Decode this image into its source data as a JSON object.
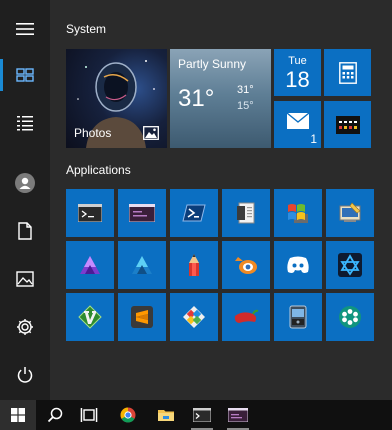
{
  "colors": {
    "tile_blue": "#0b6fc2",
    "accent": "#1a8ad4",
    "panel": "#2b2b2b",
    "taskbar": "#101010"
  },
  "rail": {
    "items": [
      {
        "name": "hamburger-menu-icon"
      },
      {
        "name": "tiles-view-icon"
      },
      {
        "name": "all-apps-list-icon"
      },
      {
        "name": "user-account-icon"
      },
      {
        "name": "documents-icon"
      },
      {
        "name": "pictures-icon"
      },
      {
        "name": "settings-gear-icon"
      },
      {
        "name": "power-icon"
      }
    ]
  },
  "groups": {
    "system": {
      "title": "System",
      "photos": {
        "label": "Photos"
      },
      "weather": {
        "condition": "Partly Sunny",
        "temp": "31°",
        "high": "31°",
        "low": "15°"
      },
      "calendar": {
        "day": "Tue",
        "date": "18"
      },
      "mail": {
        "count": "1"
      }
    },
    "applications": {
      "title": "Applications",
      "tiles": [
        {
          "icon": "terminal-icon"
        },
        {
          "icon": "console-window-icon"
        },
        {
          "icon": "powershell-icon"
        },
        {
          "icon": "document-viewer-icon"
        },
        {
          "icon": "windows-flag-icon"
        },
        {
          "icon": "control-panel-icon"
        },
        {
          "icon": "affinity-photo-icon"
        },
        {
          "icon": "affinity-designer-icon"
        },
        {
          "icon": "pencil-icon"
        },
        {
          "icon": "blender-icon"
        },
        {
          "icon": "discord-icon"
        },
        {
          "icon": "affinity-publisher-icon"
        },
        {
          "icon": "vim-icon"
        },
        {
          "icon": "sublime-text-icon"
        },
        {
          "icon": "tools-puzzle-icon"
        },
        {
          "icon": "chili-pepper-icon"
        },
        {
          "icon": "disk-utility-icon"
        },
        {
          "icon": "snowflake-icon"
        }
      ]
    }
  },
  "taskbar": {
    "items": [
      {
        "name": "start-button"
      },
      {
        "name": "search-icon"
      },
      {
        "name": "task-view-icon"
      },
      {
        "name": "chrome-icon"
      },
      {
        "name": "file-explorer-icon"
      },
      {
        "name": "terminal-icon"
      },
      {
        "name": "console-window-icon"
      }
    ]
  }
}
